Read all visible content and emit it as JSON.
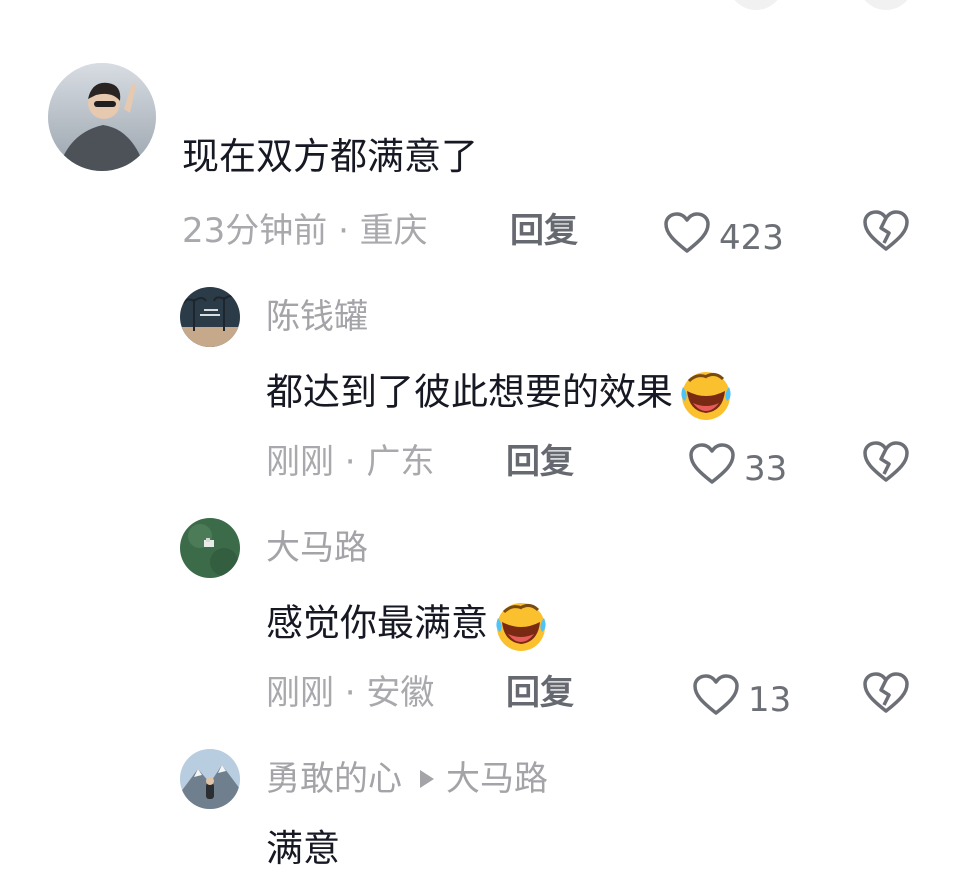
{
  "colors": {
    "text": "#161823",
    "meta": "#a8a8ad",
    "name": "#a3a3a8",
    "reply": "#666970"
  },
  "icons": {
    "like": "heart-outline-icon",
    "dislike": "broken-heart-icon",
    "emoji": "laughing-tears-emoji"
  },
  "top_comment": {
    "text": "现在双方都满意了",
    "meta": "23分钟前 · 重庆",
    "reply_label": "回复",
    "likes": "423"
  },
  "replies": [
    {
      "name": "陈钱罐",
      "text": "都达到了彼此想要的效果",
      "meta": "刚刚 · 广东",
      "reply_label": "回复",
      "likes": "33"
    },
    {
      "name": "大马路",
      "text": "感觉你最满意",
      "meta": "刚刚 · 安徽",
      "reply_label": "回复",
      "likes": "13"
    },
    {
      "name": "勇敢的心",
      "reply_to": "大马路",
      "text": "满意"
    }
  ]
}
